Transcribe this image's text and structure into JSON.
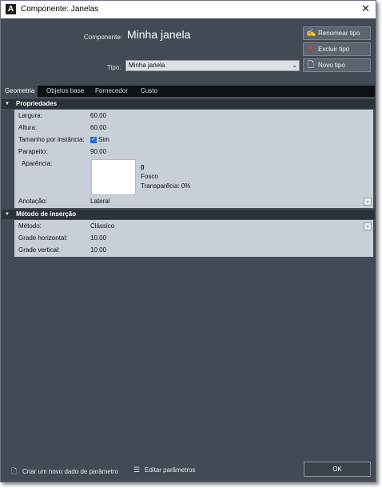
{
  "window": {
    "title": "Componente: Janelas"
  },
  "header": {
    "component_label": "Componente:",
    "component_name": "Minha janela",
    "type_label": "Tipo:",
    "type_value": "Minha janela"
  },
  "side_buttons": [
    {
      "label": "Renomear tipo",
      "icon": "rename-icon"
    },
    {
      "label": "Excluir tipo",
      "icon": "delete-icon"
    },
    {
      "label": "Novo tipo",
      "icon": "new-document-icon"
    }
  ],
  "tabs": [
    {
      "label": "Geometria",
      "active": true
    },
    {
      "label": "Objetos base",
      "active": false
    },
    {
      "label": "Fornecedor",
      "active": false
    },
    {
      "label": "Custo",
      "active": false
    }
  ],
  "properties": {
    "title": "Propriedades",
    "largura_label": "Largura:",
    "largura_value": "60.00",
    "altura_label": "Altura:",
    "altura_value": "60.00",
    "tamanho_label": "Tamanho por instância:",
    "tamanho_value": "Sim",
    "parapeito_label": "Parapeito:",
    "parapeito_value": "90.00",
    "aparencia_label": "Aparência:",
    "aparencia_number": "0",
    "aparencia_finish": "Fosco",
    "aparencia_transparency": "Transparêcia: 0%",
    "anotacao_label": "Anotação:",
    "anotacao_value": "Lateral"
  },
  "insertion": {
    "title": "Método de inserção",
    "metodo_label": "Método:",
    "metodo_value": "Clássico",
    "grade_h_label": "Grade horizontal:",
    "grade_h_value": "10.00",
    "grade_v_label": "Grade vertical:",
    "grade_v_value": "10.00"
  },
  "footer": {
    "create_param_label": "Criar um novo dado de parâmetro",
    "edit_params_label": "Editar parâmetros",
    "ok_label": "OK"
  },
  "colors": {
    "window_bg": "#414a55",
    "panel_bg": "#c9cfd6",
    "section_head": "#2c3239",
    "tabbar": "#0f1114",
    "checkbox": "#1f6fd2"
  }
}
